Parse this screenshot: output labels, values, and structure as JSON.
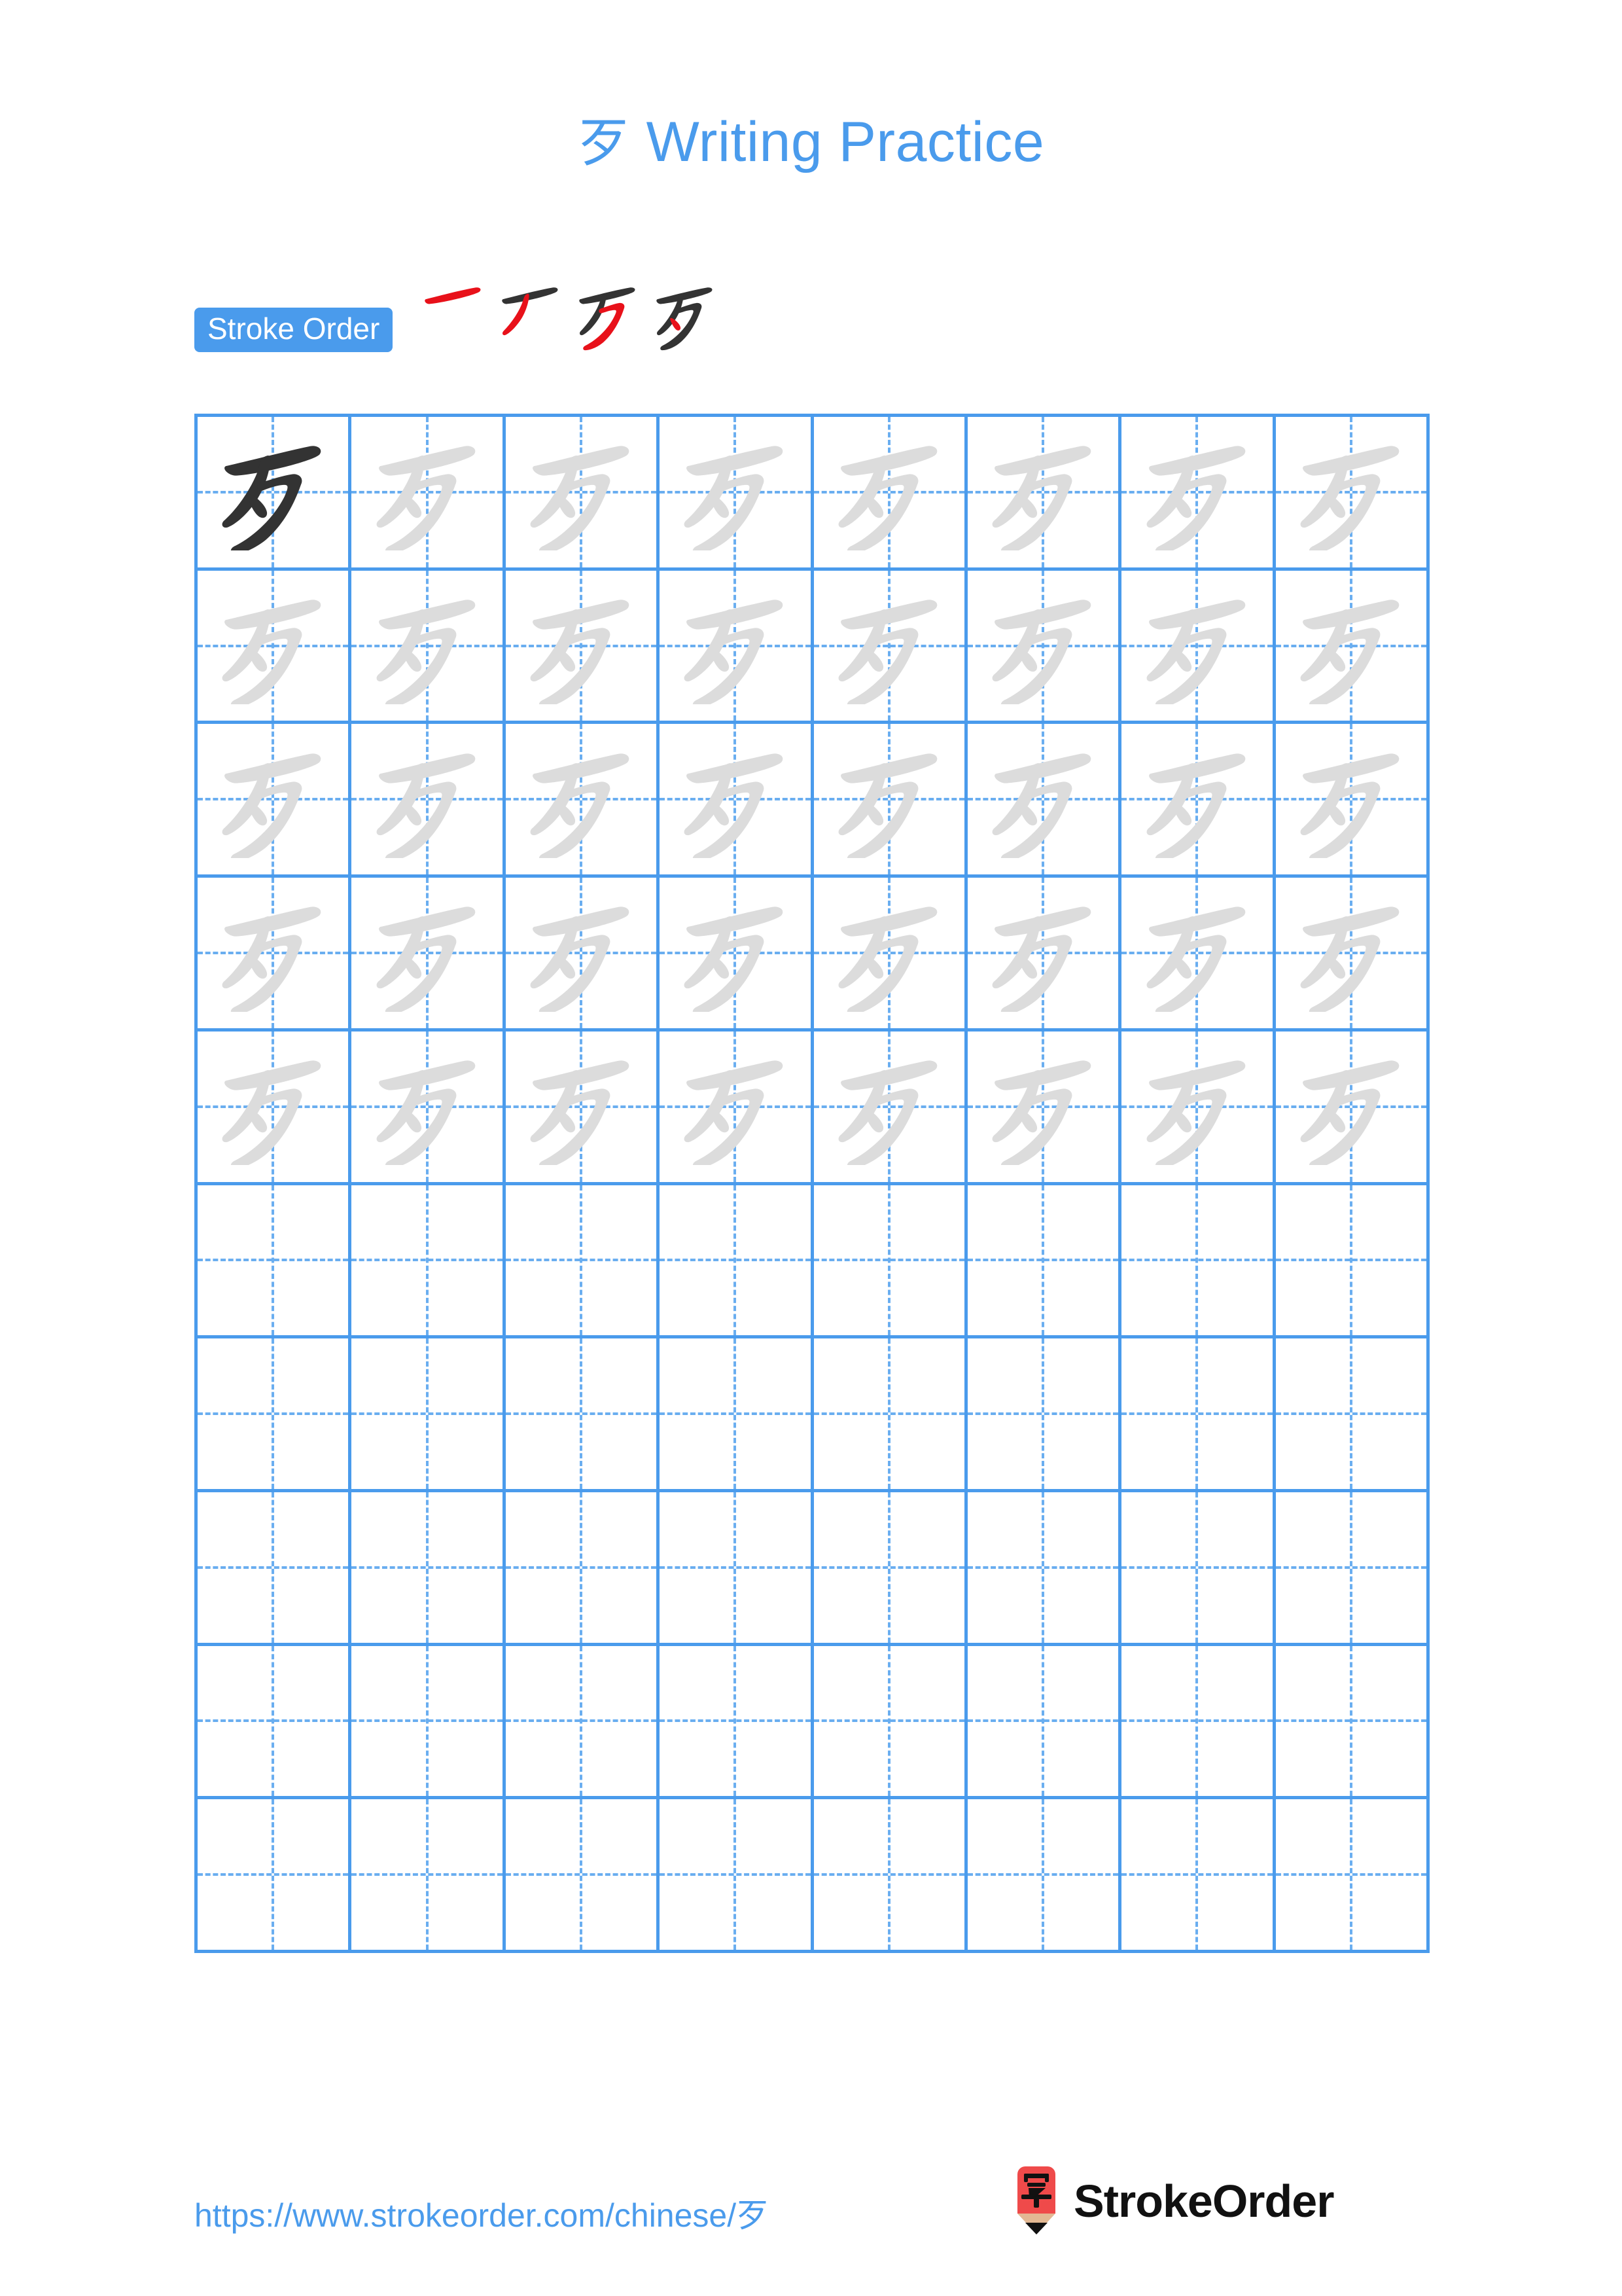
{
  "document": {
    "character": "歹",
    "title_text": "歹 Writing Practice",
    "title_prefix_char": "歹",
    "title_suffix": " Writing Practice",
    "accent_blue": "#4a9bec",
    "ink_dark": "#333333",
    "ink_light": "#dcdcdc",
    "stroke_highlight_red": "#e8111a",
    "page_background": "#ffffff"
  },
  "stroke_order": {
    "badge_label": "Stroke Order",
    "stroke_count": 4,
    "steps": [
      {
        "index": 1,
        "name": "stroke-step-1",
        "new_stroke": "horizontal",
        "new_stroke_color": "#e8111a"
      },
      {
        "index": 2,
        "name": "stroke-step-2",
        "new_stroke": "left-falling",
        "new_stroke_color": "#e8111a"
      },
      {
        "index": 3,
        "name": "stroke-step-3",
        "new_stroke": "long-sweep",
        "new_stroke_color": "#e8111a"
      },
      {
        "index": 4,
        "name": "stroke-step-4",
        "new_stroke": "dot",
        "new_stroke_color": "#e8111a"
      }
    ]
  },
  "practice_grid": {
    "columns": 8,
    "rows": 10,
    "guide_style": "dashed-crosshair",
    "rows_data": [
      {
        "row": 1,
        "cells": [
          "dark",
          "light",
          "light",
          "light",
          "light",
          "light",
          "light",
          "light"
        ]
      },
      {
        "row": 2,
        "cells": [
          "light",
          "light",
          "light",
          "light",
          "light",
          "light",
          "light",
          "light"
        ]
      },
      {
        "row": 3,
        "cells": [
          "light",
          "light",
          "light",
          "light",
          "light",
          "light",
          "light",
          "light"
        ]
      },
      {
        "row": 4,
        "cells": [
          "light",
          "light",
          "light",
          "light",
          "light",
          "light",
          "light",
          "light"
        ]
      },
      {
        "row": 5,
        "cells": [
          "light",
          "light",
          "light",
          "light",
          "light",
          "light",
          "light",
          "light"
        ]
      },
      {
        "row": 6,
        "cells": [
          "empty",
          "empty",
          "empty",
          "empty",
          "empty",
          "empty",
          "empty",
          "empty"
        ]
      },
      {
        "row": 7,
        "cells": [
          "empty",
          "empty",
          "empty",
          "empty",
          "empty",
          "empty",
          "empty",
          "empty"
        ]
      },
      {
        "row": 8,
        "cells": [
          "empty",
          "empty",
          "empty",
          "empty",
          "empty",
          "empty",
          "empty",
          "empty"
        ]
      },
      {
        "row": 9,
        "cells": [
          "empty",
          "empty",
          "empty",
          "empty",
          "empty",
          "empty",
          "empty",
          "empty"
        ]
      },
      {
        "row": 10,
        "cells": [
          "empty",
          "empty",
          "empty",
          "empty",
          "empty",
          "empty",
          "empty",
          "empty"
        ]
      }
    ]
  },
  "footer": {
    "url_text": "https://www.strokeorder.com/chinese/歹",
    "brand_name": "StrokeOrder",
    "brand_icon_char": "字",
    "brand_icon_body_color": "#ef4a4a",
    "brand_icon_wood_color": "#e3b893",
    "brand_icon_tip_color": "#111111"
  }
}
